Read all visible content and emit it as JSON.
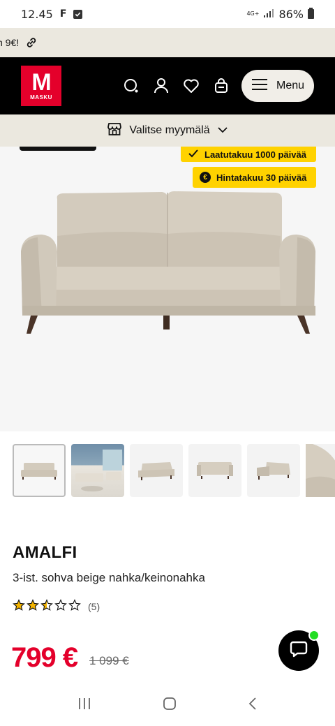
{
  "status_bar": {
    "time": "12.45",
    "f_indicator": "F",
    "network": "4G+",
    "battery": "86%"
  },
  "promo": {
    "text": "n 9€!"
  },
  "header": {
    "logo_letter": "M",
    "logo_text": "MASKU",
    "menu_label": "Menu"
  },
  "store": {
    "label": "Valitse myymälä"
  },
  "badges": {
    "quality": "Laatutakuu 1000 päivää",
    "price": "Hintatakuu 30 päivää",
    "euro_symbol": "€"
  },
  "product": {
    "name": "AMALFI",
    "description": "3-ist. sohva beige nahka/keinonahka",
    "rating_value": 2.5,
    "rating_max": 5,
    "rating_count": "(5)",
    "price": "799 €",
    "old_price": "1 099 €"
  },
  "colors": {
    "brand_red": "#e4002b",
    "badge_yellow": "#ffd200",
    "beige_bar": "#ebe8df",
    "header_black": "#000000",
    "online_green": "#22dd22"
  }
}
